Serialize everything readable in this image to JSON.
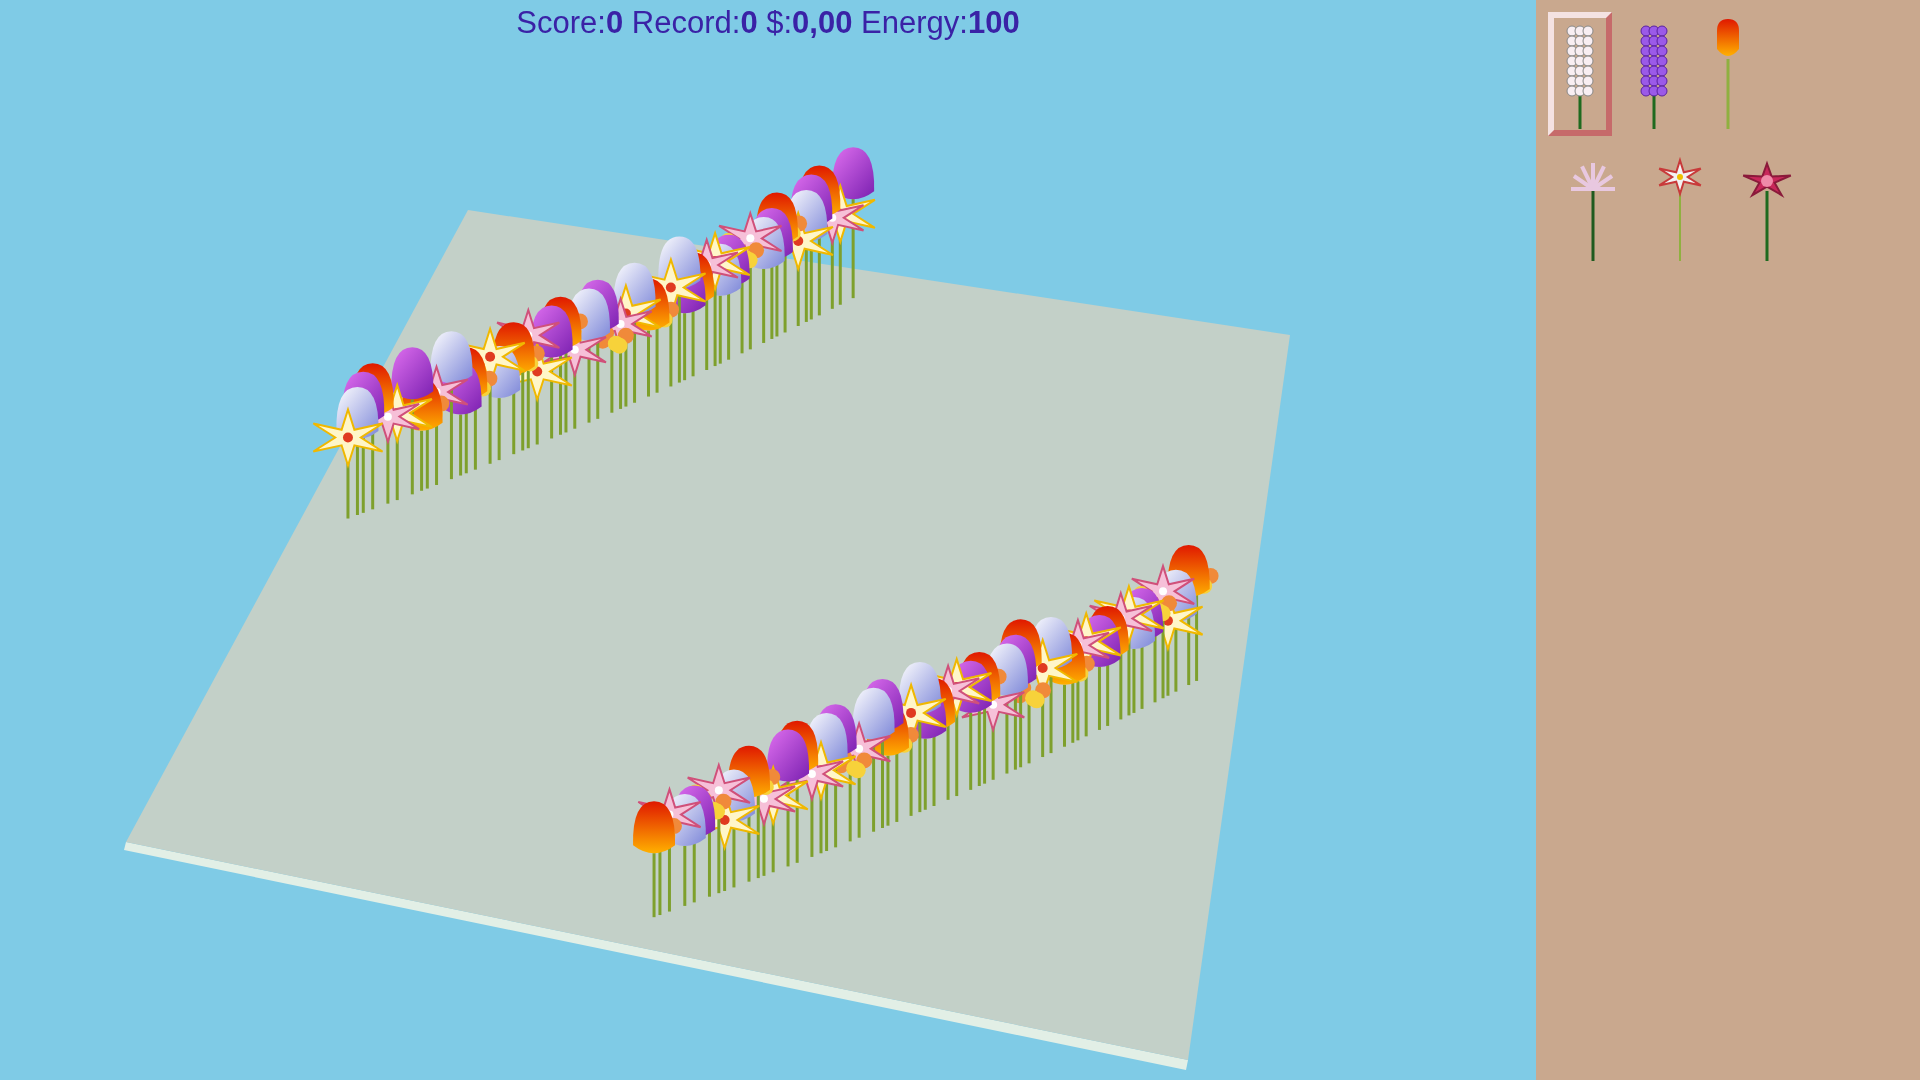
{
  "hud": {
    "text": "Score:**0** Record:**0** $:**0,00** Energy:**100**"
  },
  "palette": [
    {
      "kind": "hyacinth-white",
      "selected": true
    },
    {
      "kind": "hyacinth-purple",
      "selected": false
    },
    {
      "kind": "tulip",
      "selected": false
    },
    {
      "kind": "nerine",
      "selected": false
    },
    {
      "kind": "lily",
      "selected": false
    },
    {
      "kind": "orchid",
      "selected": false
    }
  ]
}
